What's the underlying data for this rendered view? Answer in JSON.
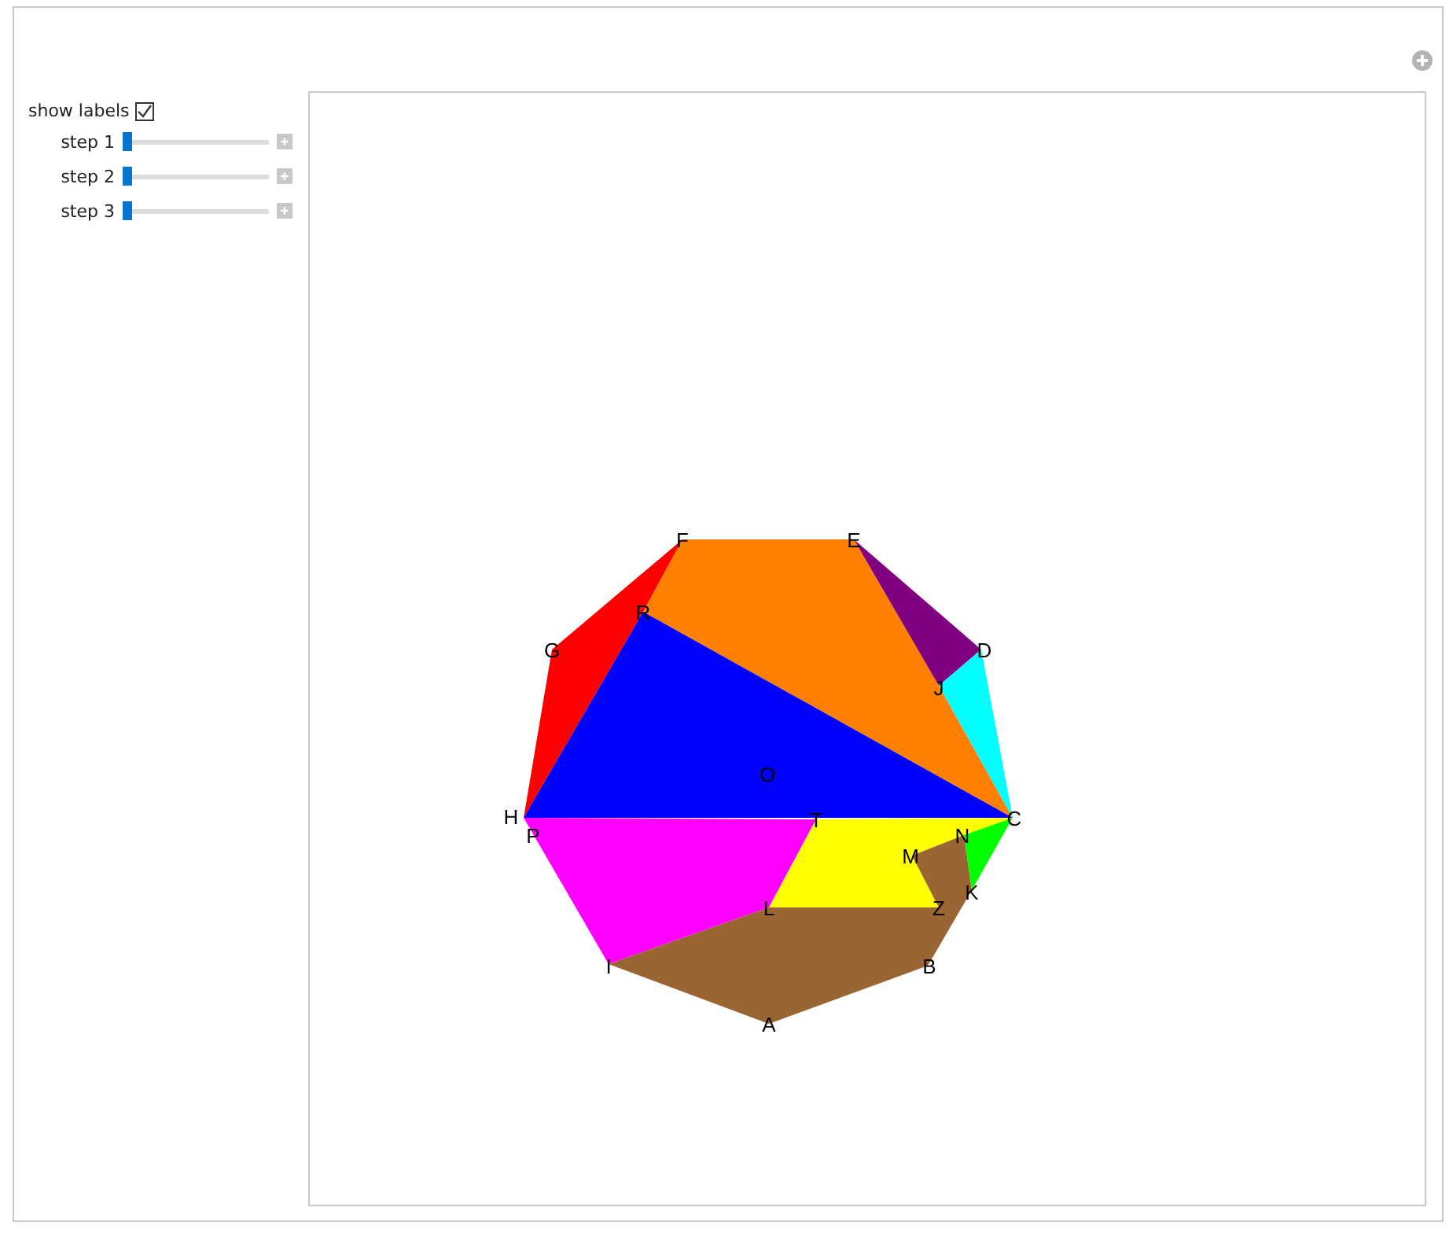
{
  "controls": {
    "show_labels": {
      "label": "show labels",
      "checked": true
    },
    "sliders": [
      {
        "label": "step 1",
        "level": 0
      },
      {
        "label": "step 2",
        "level": 0
      },
      {
        "label": "step 3",
        "level": 0
      }
    ]
  },
  "diagram": {
    "pieces": [
      {
        "color": "#ff0000"
      },
      {
        "color": "#ff7f00"
      },
      {
        "color": "#800080"
      },
      {
        "color": "#00ffff"
      },
      {
        "color": "#0000ff"
      },
      {
        "color": "#ff00ff"
      },
      {
        "color": "#ffff00"
      },
      {
        "color": "#996633"
      },
      {
        "color": "#00ff00"
      }
    ],
    "labels": [
      "F",
      "E",
      "R",
      "G",
      "D",
      "J",
      "O",
      "H",
      "P",
      "T",
      "C",
      "N",
      "M",
      "K",
      "L",
      "Z",
      "I",
      "B",
      "A"
    ]
  }
}
